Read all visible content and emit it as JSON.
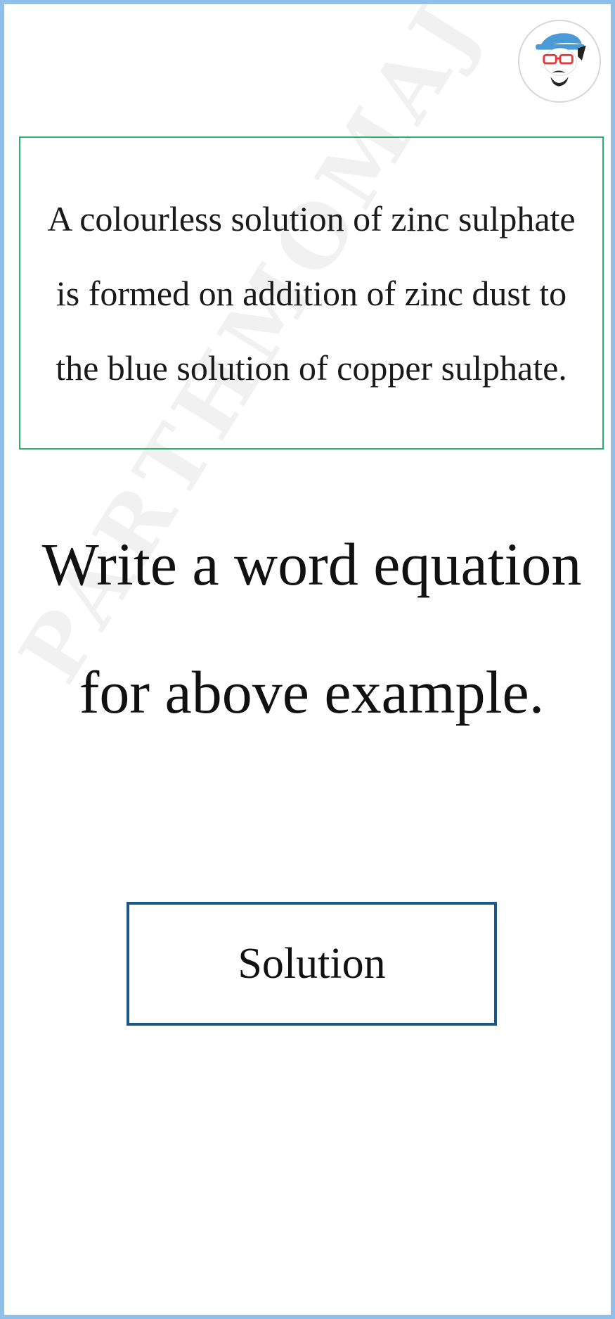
{
  "watermark": {
    "text": "PARTHMOMAJ"
  },
  "avatar": {
    "icon": "cartoon-avatar-icon"
  },
  "question": {
    "text": "A colourless solution of  zinc sulphate is formed on addition of  zinc dust to the blue solution of  copper sulphate."
  },
  "prompt": {
    "text": "Write a word equation for above example."
  },
  "solution_button": {
    "label": "Solution"
  },
  "colors": {
    "frame_border": "#8ec0ea",
    "question_border": "#2fad6a",
    "button_border": "#1a5688"
  }
}
